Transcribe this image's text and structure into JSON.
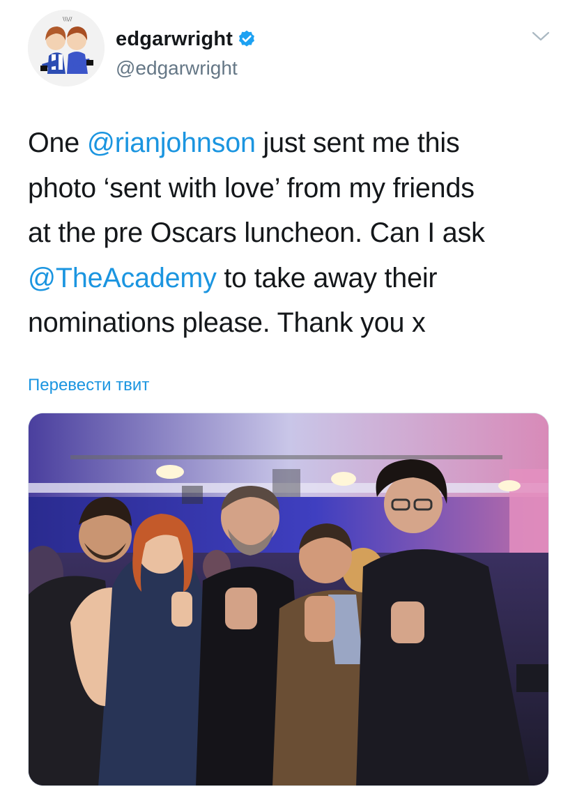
{
  "author": {
    "display_name": "edgarwright",
    "handle": "@edgarwright",
    "verified": true,
    "avatar_icon": "avatar-illustration-icon"
  },
  "tweet": {
    "lines": [
      [
        {
          "text": "One ",
          "type": "text"
        },
        {
          "text": "@rianjohnson",
          "type": "mention"
        },
        {
          "text": " just sent me this",
          "type": "text"
        }
      ],
      [
        {
          "text": "photo ‘sent with love’ from my friends",
          "type": "text"
        }
      ],
      [
        {
          "text": "at the pre Oscars luncheon. Can I ask",
          "type": "text"
        }
      ],
      [
        {
          "text": "@TheAcademy",
          "type": "mention"
        },
        {
          "text": " to take away their",
          "type": "text"
        }
      ],
      [
        {
          "text": "nominations please. Thank you x",
          "type": "text"
        }
      ]
    ]
  },
  "translate_label": "Перевести твит",
  "colors": {
    "link": "#1b95e0",
    "text": "#14171a",
    "secondary": "#657786"
  },
  "icons": {
    "verified": "verified-badge-icon",
    "menu": "chevron-down-icon"
  }
}
